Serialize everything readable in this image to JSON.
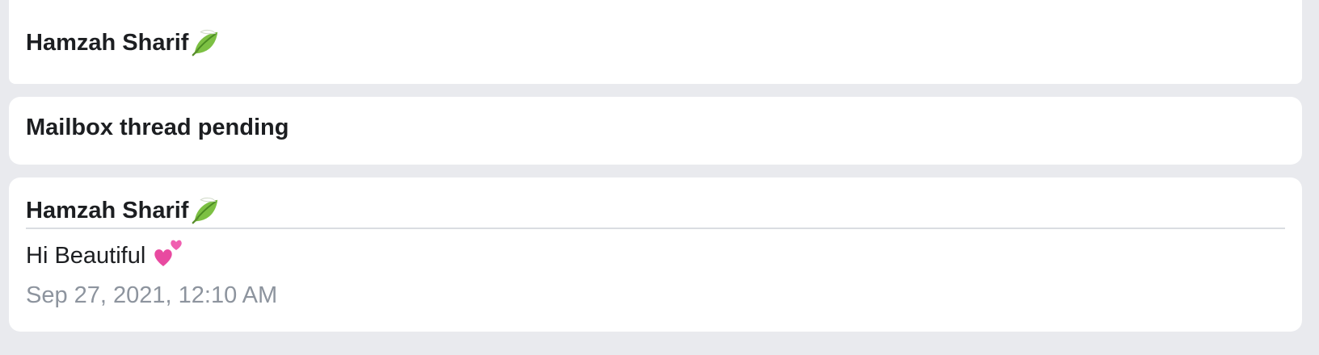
{
  "cards": [
    {
      "sender": "Hamzah Sharif",
      "sender_emoji": "leaf-emoji-icon"
    },
    {
      "title": "Mailbox thread pending"
    },
    {
      "sender": "Hamzah Sharif",
      "sender_emoji": "leaf-emoji-icon",
      "message": "Hi Beautiful",
      "message_emoji": "two-hearts-emoji-icon",
      "timestamp": "Sep 27, 2021, 12:10 AM"
    }
  ],
  "colors": {
    "background": "#e9eaee",
    "card": "#ffffff",
    "text": "#1c1e21",
    "muted": "#8d949e",
    "divider": "#dadde1"
  }
}
